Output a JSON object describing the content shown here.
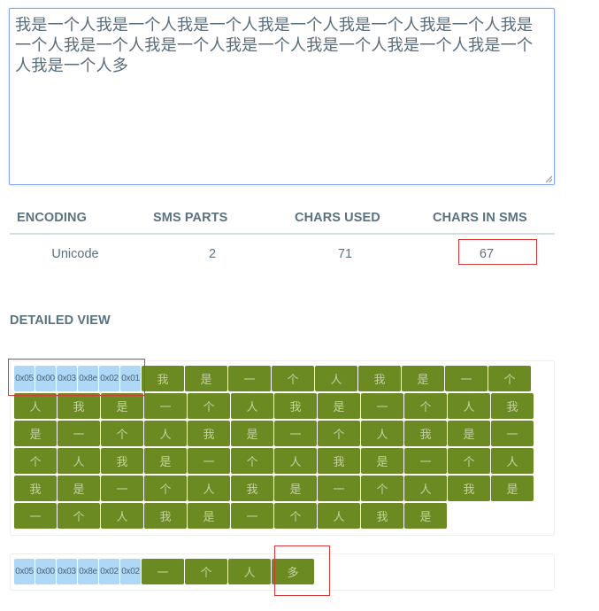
{
  "message": {
    "text": "我是一个人我是一个人我是一个人我是一个人我是一个人我是一个人我是一个人我是一个人我是一个人我是一个人我是一个人我是一个人我是一个人我是一个人多"
  },
  "stats": {
    "headers": {
      "encoding": "ENCODING",
      "sms_parts": "SMS PARTS",
      "chars_used": "CHARS USED",
      "chars_in_sms": "CHARS IN SMS"
    },
    "values": {
      "encoding": "Unicode",
      "sms_parts": "2",
      "chars_used": "71",
      "chars_in_sms": "67"
    }
  },
  "detailed_view": {
    "title": "DETAILED VIEW",
    "parts": [
      {
        "udh": [
          "0x05",
          "0x00",
          "0x03",
          "0x8e",
          "0x02",
          "0x01"
        ],
        "chars": [
          "我",
          "是",
          "一",
          "个",
          "人",
          "我",
          "是",
          "一",
          "个",
          "人",
          "我",
          "是",
          "一",
          "个",
          "人",
          "我",
          "是",
          "一",
          "个",
          "人",
          "我",
          "是",
          "一",
          "个",
          "人",
          "我",
          "是",
          "一",
          "个",
          "人",
          "我",
          "是",
          "一",
          "个",
          "人",
          "我",
          "是",
          "一",
          "个",
          "人",
          "我",
          "是",
          "一",
          "个",
          "人",
          "我",
          "是",
          "一",
          "个",
          "人",
          "我",
          "是",
          "一",
          "个",
          "人",
          "我",
          "是",
          "一",
          "个",
          "人",
          "我",
          "是",
          "一",
          "个",
          "人",
          "我",
          "是"
        ]
      },
      {
        "udh": [
          "0x05",
          "0x00",
          "0x03",
          "0x8e",
          "0x02",
          "0x02"
        ],
        "chars": [
          "一",
          "个",
          "人",
          "多"
        ]
      }
    ]
  },
  "colors": {
    "udh_cell": "#aed8f5",
    "char_cell": "#6b8b22",
    "highlight_border": "#d33a3a",
    "textarea_border": "#86a7f0"
  }
}
